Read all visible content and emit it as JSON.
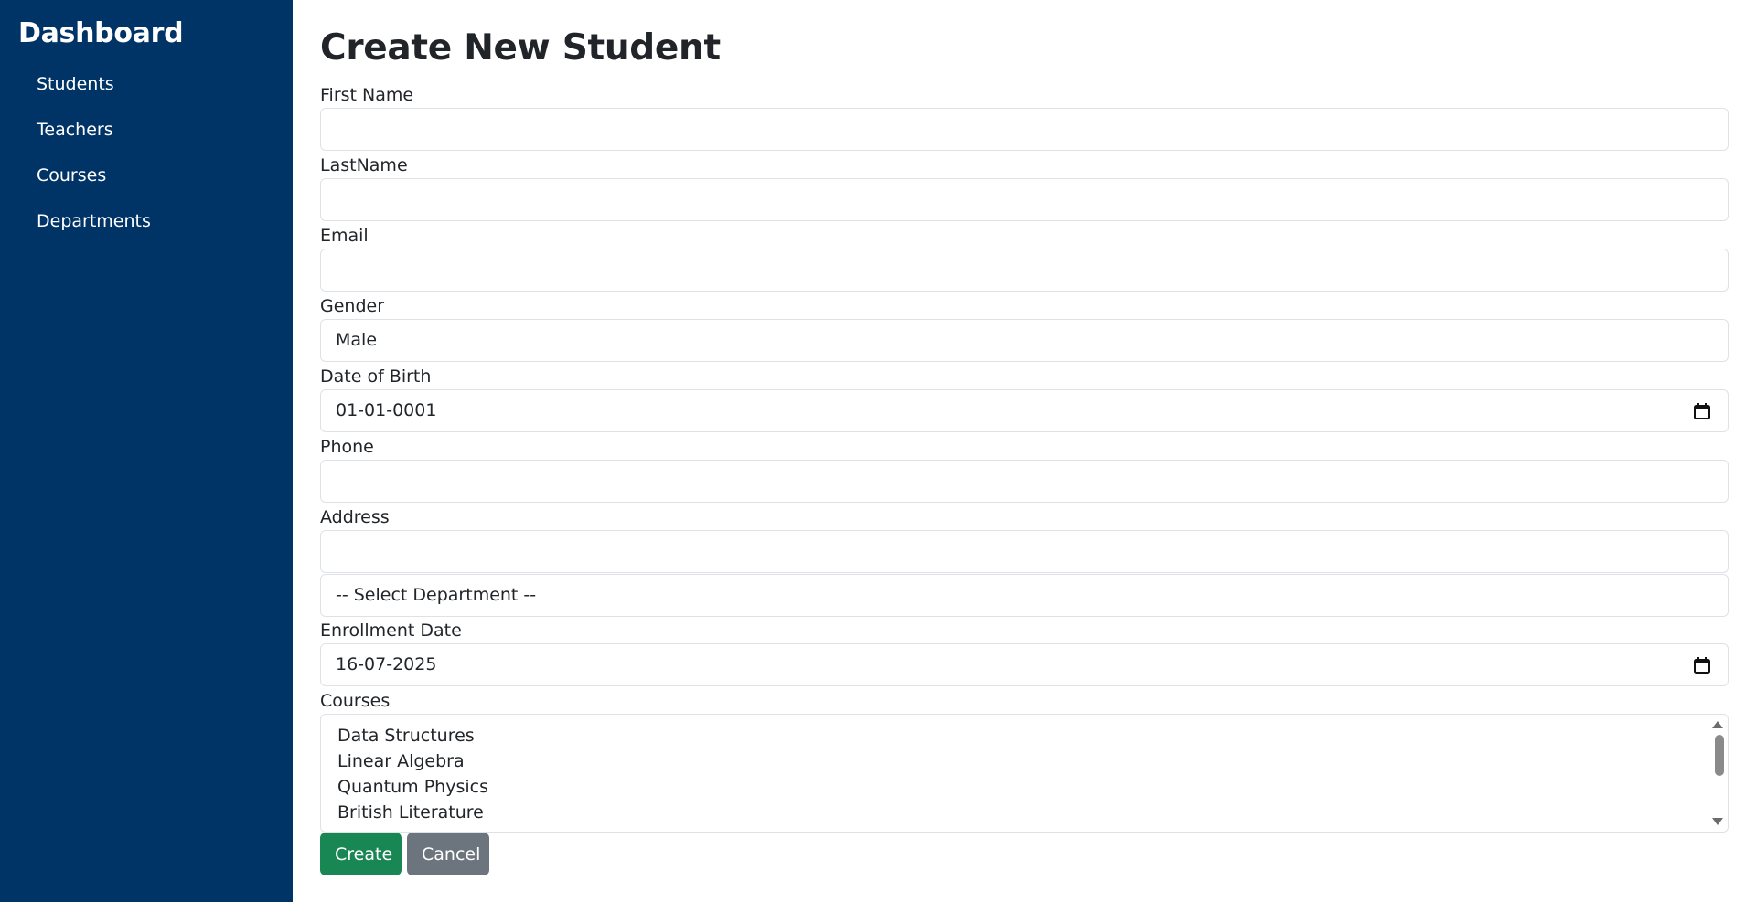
{
  "sidebar": {
    "title": "Dashboard",
    "items": [
      {
        "label": "Students"
      },
      {
        "label": "Teachers"
      },
      {
        "label": "Courses"
      },
      {
        "label": "Departments"
      }
    ]
  },
  "form": {
    "title": "Create New Student",
    "first_name": {
      "label": "First Name",
      "value": ""
    },
    "last_name": {
      "label": "LastName",
      "value": ""
    },
    "email": {
      "label": "Email",
      "value": ""
    },
    "gender": {
      "label": "Gender",
      "value": "Male"
    },
    "dob": {
      "label": "Date of Birth",
      "value": "01-01-0001"
    },
    "phone": {
      "label": "Phone",
      "value": ""
    },
    "address": {
      "label": "Address",
      "value": ""
    },
    "department": {
      "value": "-- Select Department --"
    },
    "enrollment_date": {
      "label": "Enrollment Date",
      "value": "16-07-2025"
    },
    "courses": {
      "label": "Courses",
      "options": [
        "Data Structures",
        "Linear Algebra",
        "Quantum Physics",
        "British Literature"
      ]
    },
    "create_label": "Create",
    "cancel_label": "Cancel"
  },
  "colors": {
    "sidebar_bg": "#003366",
    "create_btn": "#198754",
    "cancel_btn": "#6c757d"
  }
}
